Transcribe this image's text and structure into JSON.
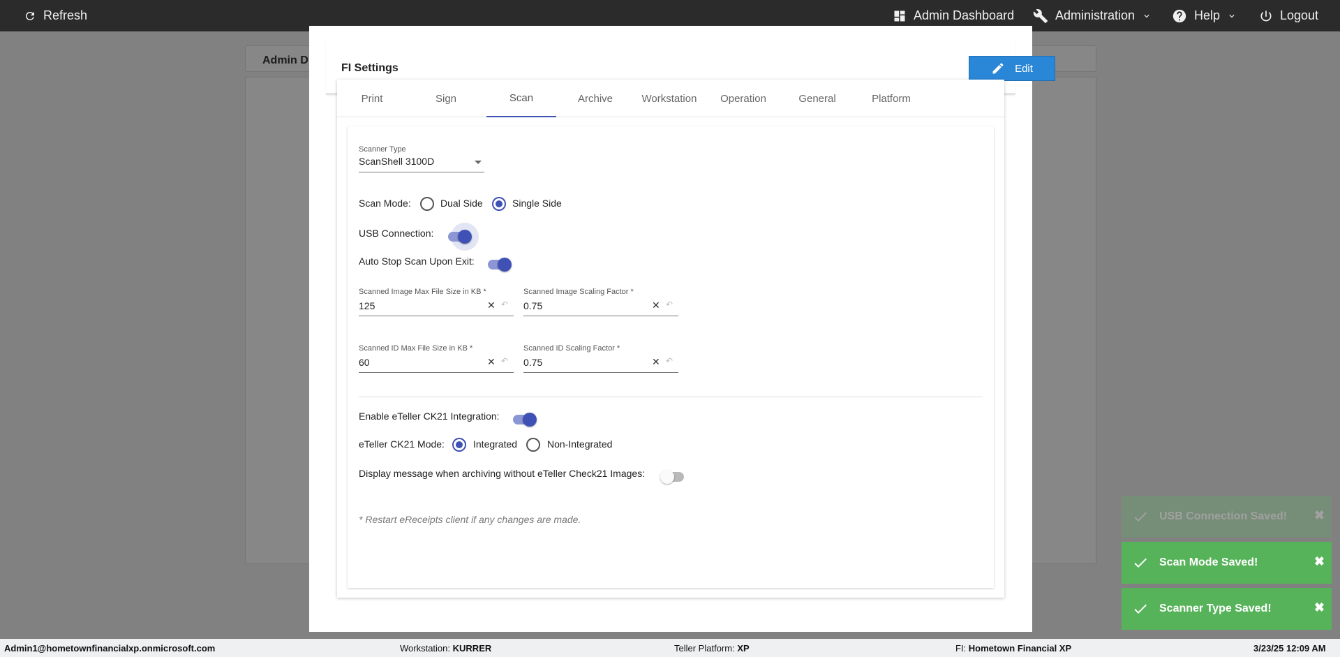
{
  "topbar": {
    "refresh": "Refresh",
    "admin_dashboard": "Admin Dashboard",
    "administration": "Administration",
    "help": "Help",
    "logout": "Logout"
  },
  "background": {
    "tab_label": "Admin D"
  },
  "modal": {
    "title": "FI Settings",
    "edit_label": "Edit",
    "tabs": [
      "Print",
      "Sign",
      "Scan",
      "Archive",
      "Workstation",
      "Operation",
      "General",
      "Platform"
    ],
    "active_tab": "Scan"
  },
  "scan": {
    "scanner_type_label": "Scanner Type",
    "scanner_type_value": "ScanShell 3100D",
    "scan_mode_label": "Scan Mode:",
    "scan_mode_options": [
      "Dual Side",
      "Single Side"
    ],
    "scan_mode_selected": "Single Side",
    "usb_label": "USB Connection:",
    "usb_on": true,
    "auto_stop_label": "Auto Stop Scan Upon Exit:",
    "auto_stop_on": true,
    "fields": [
      {
        "label": "Scanned Image Max File Size in KB *",
        "value": "125"
      },
      {
        "label": "Scanned Image Scaling Factor *",
        "value": "0.75"
      },
      {
        "label": "Scanned ID Max File Size in KB *",
        "value": "60"
      },
      {
        "label": "Scanned ID Scaling Factor *",
        "value": "0.75"
      }
    ],
    "ck21_label": "Enable eTeller CK21 Integration:",
    "ck21_on": true,
    "ck21_mode_label": "eTeller CK21 Mode:",
    "ck21_mode_options": [
      "Integrated",
      "Non-Integrated"
    ],
    "ck21_mode_selected": "Integrated",
    "display_msg_label": "Display message when archiving without eTeller Check21 Images:",
    "display_msg_on": false,
    "note": "* Restart eReceipts client if any changes are made."
  },
  "toasts": [
    {
      "text": "USB Connection Saved!",
      "fading": true
    },
    {
      "text": "Scan Mode Saved!",
      "fading": false
    },
    {
      "text": "Scanner Type Saved!",
      "fading": false
    }
  ],
  "statusbar": {
    "user": "Admin1@hometownfinancialxp.onmicrosoft.com",
    "workstation_label": "Workstation:",
    "workstation_value": "KURRER",
    "platform_label": "Teller Platform:",
    "platform_value": "XP",
    "fi_label": "FI:",
    "fi_value": "Hometown Financial XP",
    "datetime": "3/23/25 12:09 AM"
  },
  "colors": {
    "accent": "#3f51b5",
    "edit_button": "#2a86d6",
    "toast": "#57b35a",
    "topbar": "#2b2b2b"
  }
}
